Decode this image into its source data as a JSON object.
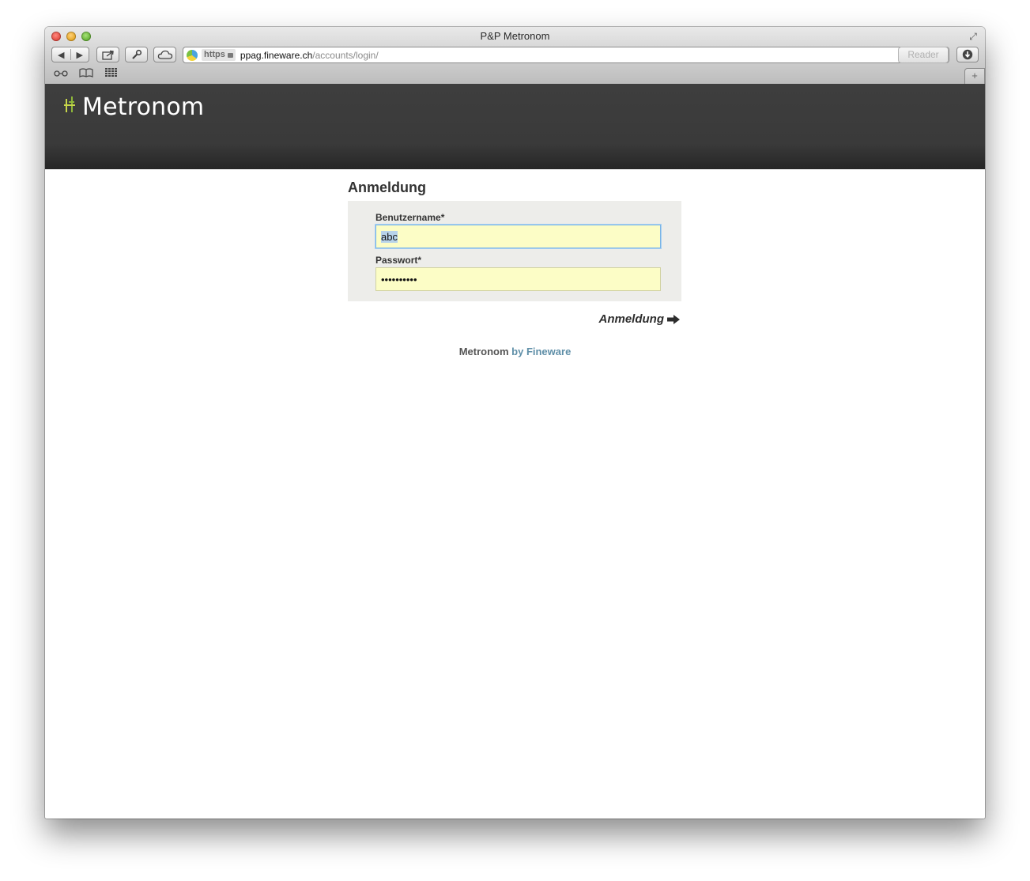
{
  "window": {
    "title": "P&P Metronom"
  },
  "toolbar": {
    "back_icon": "back-arrow-icon",
    "forward_icon": "forward-arrow-icon",
    "share_icon": "share-icon",
    "tools_icon": "tools-icon",
    "cloud_icon": "icloud-icon",
    "download_icon": "downloads-icon",
    "reader_label": "Reader",
    "newtab_label": "+"
  },
  "address_bar": {
    "https_label": "https",
    "host": "ppag.fineware.ch",
    "path": "/accounts/login/"
  },
  "bookmarks_bar": {
    "icons": [
      "reading-list-icon",
      "bookmarks-icon",
      "top-sites-icon"
    ]
  },
  "header": {
    "logo_text": "Metronom",
    "logo_colors": [
      "#c8d64a",
      "#8fb83a"
    ]
  },
  "login": {
    "title": "Anmeldung",
    "username_label": "Benutzername*",
    "username_value": "abc",
    "password_label": "Passwort*",
    "password_value": "••••••••••",
    "submit_label": "Anmeldung"
  },
  "footer": {
    "brand": "Metronom",
    "by_text": "by Fineware"
  },
  "colors": {
    "header_bg": "#3b3b3b",
    "form_bg": "#ededea",
    "input_bg": "#fcfdc6",
    "link": "#5f8fa8"
  }
}
